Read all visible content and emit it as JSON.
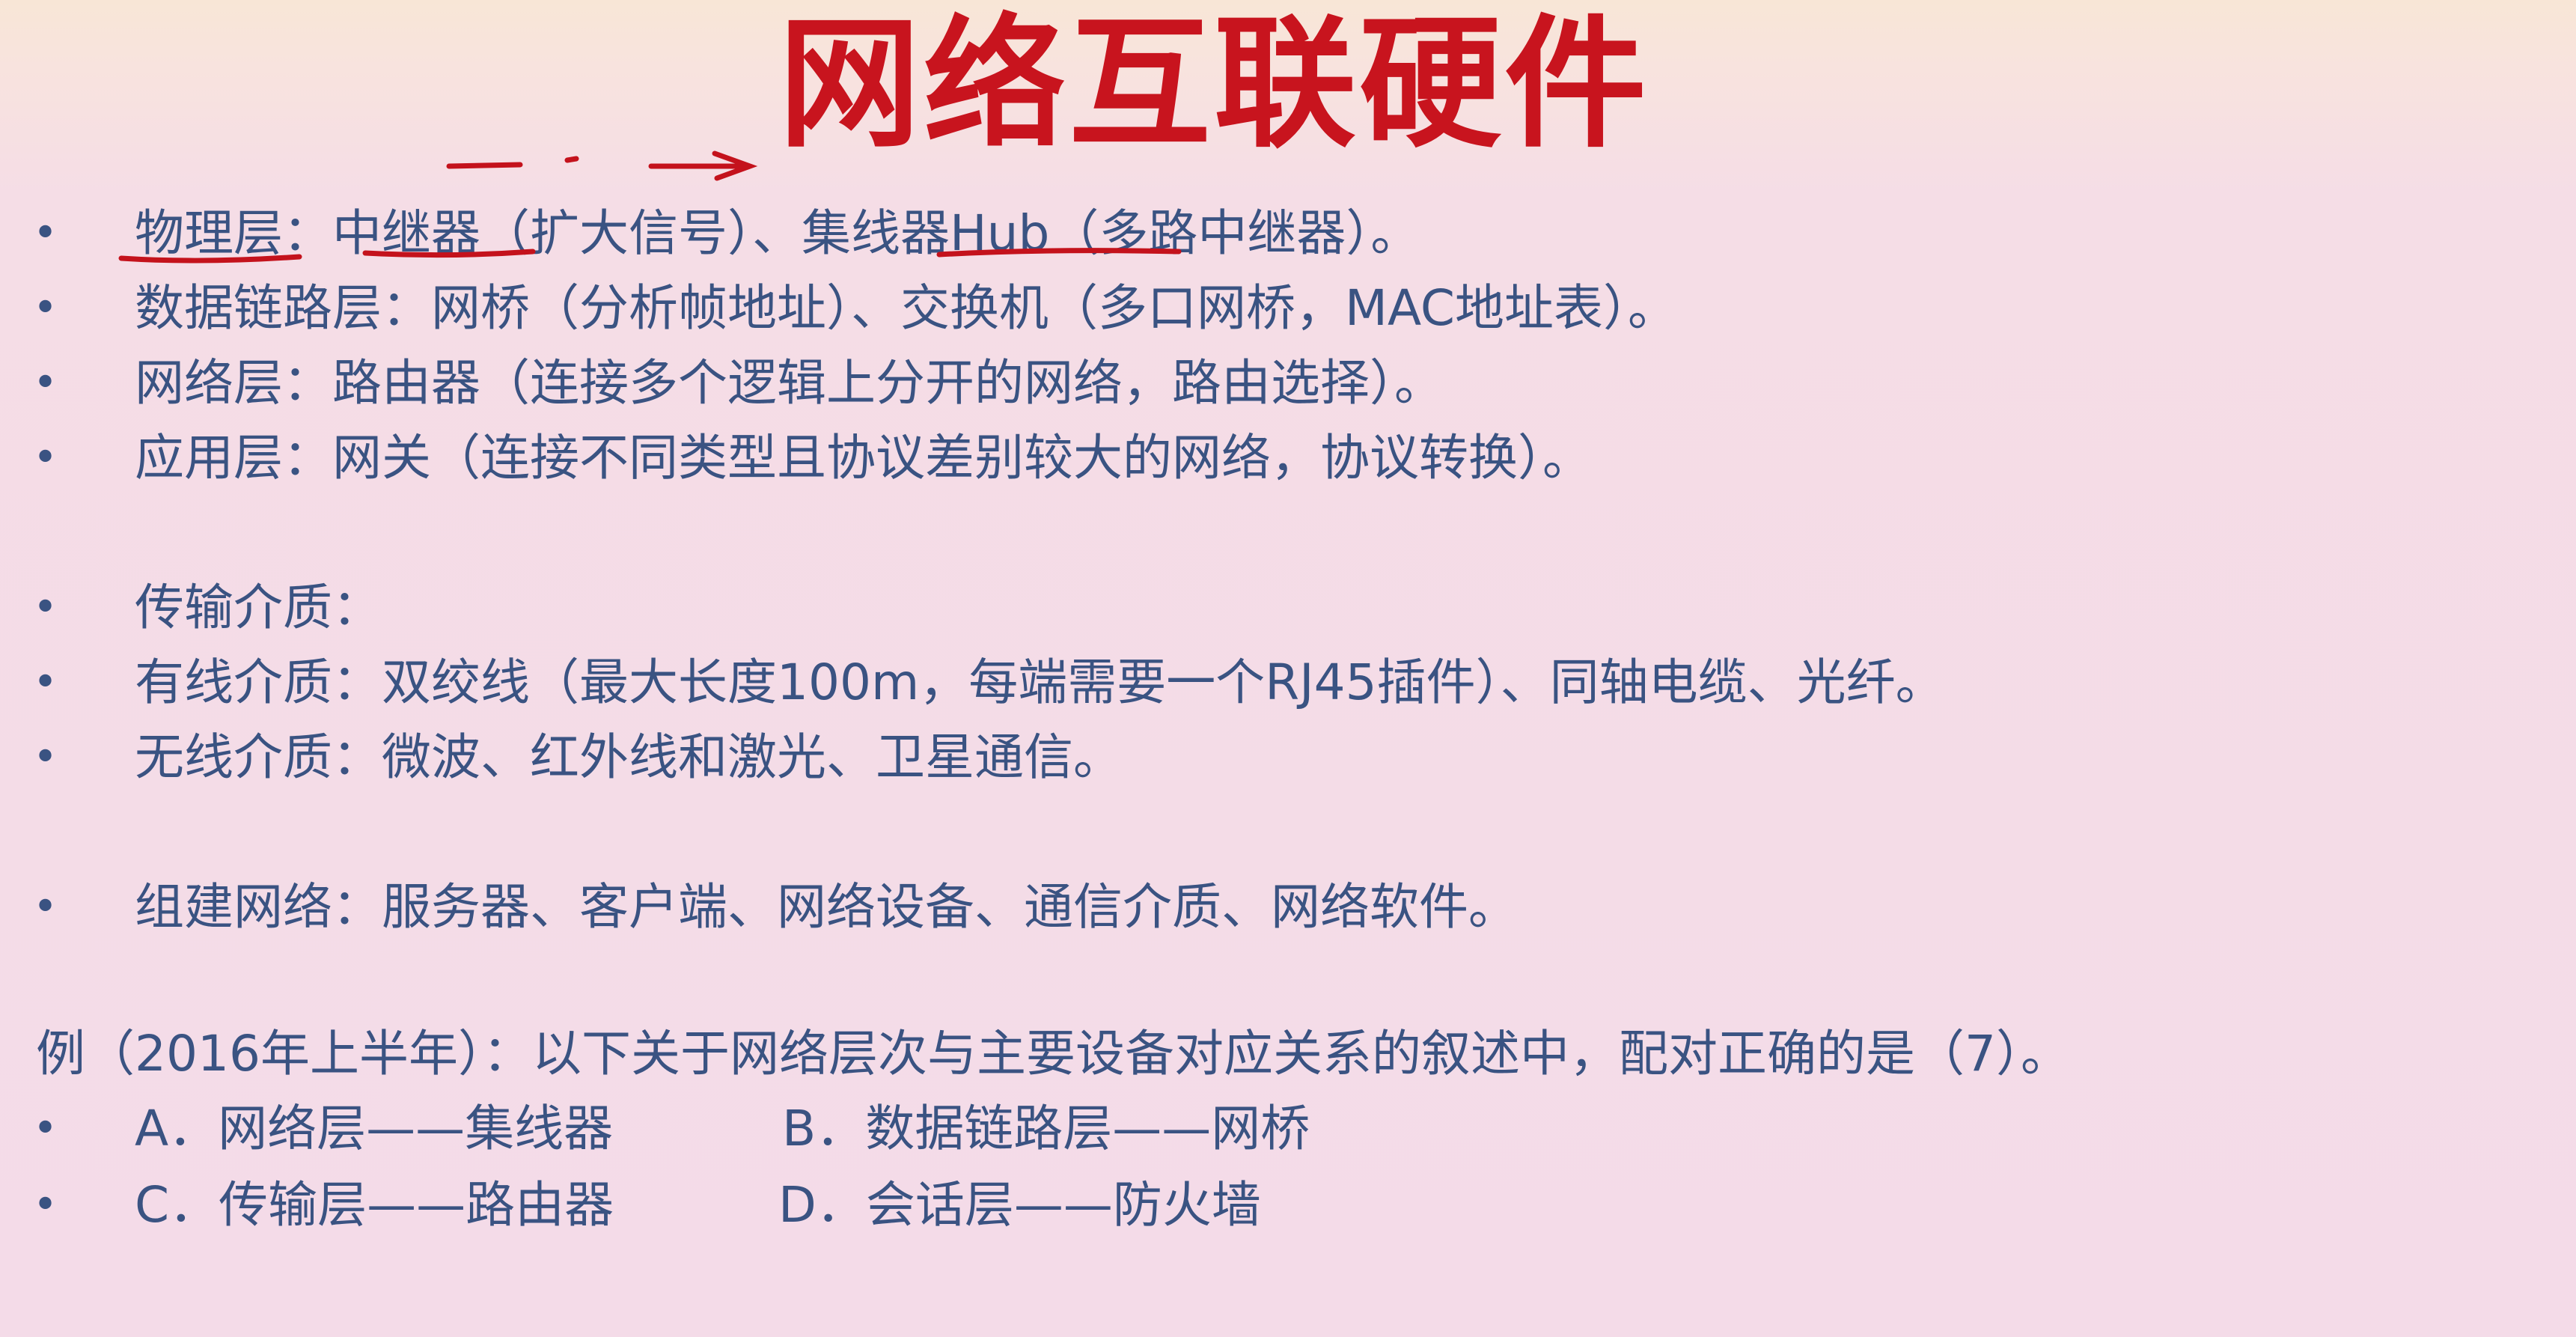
{
  "slide": {
    "title": "网络互联硬件",
    "layers": [
      {
        "label": "物理层：",
        "device1": "中继器",
        "mid": "（扩大信号）、",
        "device2": "集线器Hub",
        "rest": "（多路中继器）。"
      },
      {
        "text": "数据链路层：网桥（分析帧地址）、交换机（多口网桥，MAC地址表）。"
      },
      {
        "text": "网络层：路由器（连接多个逻辑上分开的网络，路由选择）。"
      },
      {
        "text": "应用层：网关（连接不同类型且协议差别较大的网络，协议转换）。"
      }
    ],
    "media": {
      "heading": "传输介质：",
      "wired": "有线介质：双绞线（最大长度100m，每端需要一个RJ45插件）、同轴电缆、光纤。",
      "wireless": "无线介质：微波、红外线和激光、卫星通信。"
    },
    "build": "组建网络：服务器、客户端、网络设备、通信介质、网络软件。",
    "example": {
      "question": "例（2016年上半年）：以下关于网络层次与主要设备对应关系的叙述中，配对正确的是（7）。",
      "options": [
        {
          "a": "A．网络层——集线器",
          "b": "B．数据链路层——网桥"
        },
        {
          "a": "C．传输层——路由器",
          "b": "D．会话层——防火墙"
        }
      ]
    },
    "bullet_char": "•",
    "colors": {
      "title": "#c8141e",
      "body": "#3a5382",
      "annotation": "#c4121c"
    }
  }
}
